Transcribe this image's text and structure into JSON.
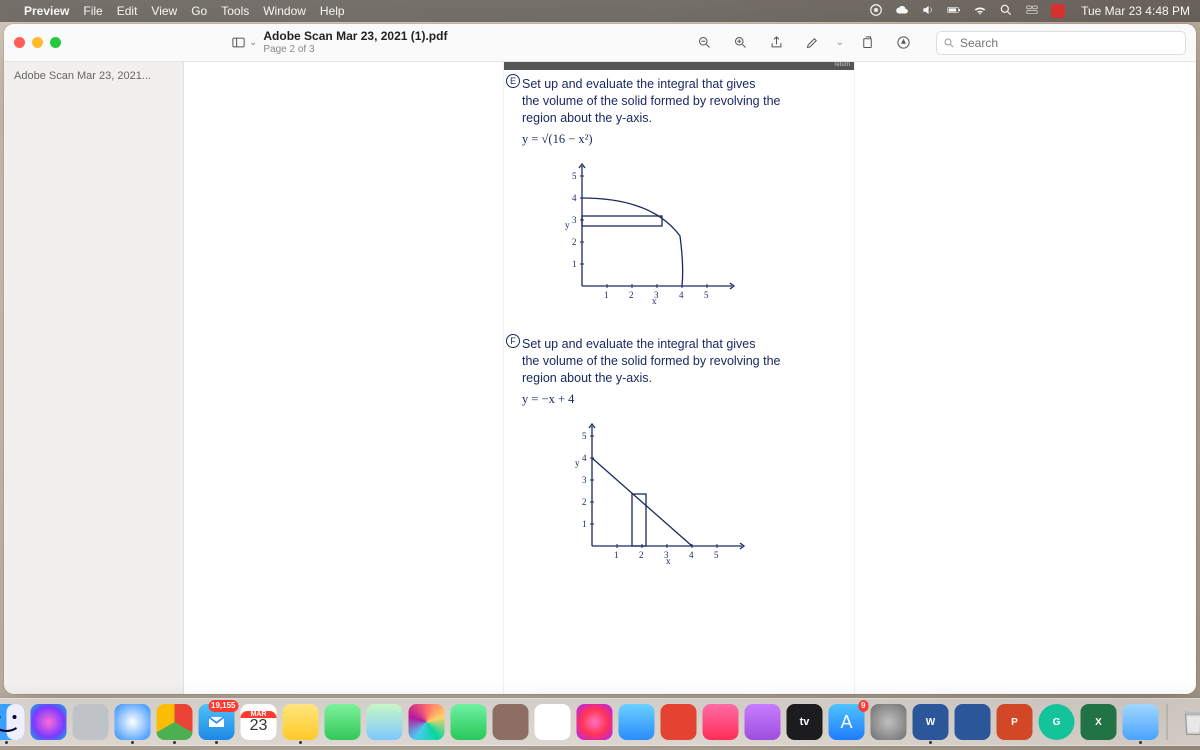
{
  "menubar": {
    "app": "Preview",
    "items": [
      "File",
      "Edit",
      "View",
      "Go",
      "Tools",
      "Window",
      "Help"
    ],
    "clock": "Tue Mar 23  4:48 PM"
  },
  "window": {
    "title": "Adobe Scan Mar 23, 2021 (1).pdf",
    "subtitle": "Page 2 of 3",
    "search_placeholder": "Search",
    "sidebar_label": "Adobe Scan Mar 23, 2021..."
  },
  "page": {
    "ruler_label": "return",
    "problem_e": {
      "id": "E",
      "lines": [
        "Set up and evaluate the integral that gives",
        "the volume of the solid formed by revolving the",
        "region about the y-axis.",
        "y = √(16 − x²)"
      ],
      "graph": {
        "ylabel": "y",
        "xlabel": "x",
        "xticks": [
          "1",
          "2",
          "3",
          "4",
          "5"
        ],
        "yticks": [
          "1",
          "2",
          "3",
          "4",
          "5"
        ]
      }
    },
    "problem_f": {
      "id": "F",
      "lines": [
        "Set up and evaluate the integral that gives",
        "the volume of the solid formed by revolving the",
        "region about the y-axis.",
        "y = −x + 4"
      ],
      "graph": {
        "ylabel": "y",
        "xlabel": "x",
        "xticks": [
          "1",
          "2",
          "3",
          "4",
          "5"
        ],
        "yticks": [
          "1",
          "2",
          "3",
          "4",
          "5"
        ]
      }
    }
  },
  "dock": {
    "calendar_month": "MAR",
    "calendar_day": "23",
    "mail_badge": "19,155",
    "appstore_badge": "9",
    "tv_label": "tv",
    "items": [
      {
        "name": "finder",
        "bg": "linear-gradient(#3aa0ff,#0a5cd8)"
      },
      {
        "name": "siri",
        "bg": "radial-gradient(circle,#ff6bd6,#7a3bff 60%,#0bd 100%)"
      },
      {
        "name": "launchpad",
        "bg": "#bfc3c8"
      },
      {
        "name": "safari",
        "bg": "radial-gradient(circle,#fff,#2a8cff)"
      },
      {
        "name": "chrome",
        "bg": "conic-gradient(#ea4335 0 120deg,#4caf50 120deg 240deg,#fbbc05 240deg 360deg)"
      },
      {
        "name": "mail",
        "bg": "linear-gradient(#4fc3f7,#1e88e5)"
      },
      {
        "name": "calendar",
        "bg": "#fff"
      },
      {
        "name": "notes",
        "bg": "linear-gradient(#ffe57f,#ffca28)"
      },
      {
        "name": "messages",
        "bg": "linear-gradient(#7cf29a,#33c75a)"
      },
      {
        "name": "maps",
        "bg": "linear-gradient(#c8f7c5,#7ec8ff)"
      },
      {
        "name": "photos",
        "bg": "conic-gradient(#ff6b6b,#ffd166,#06d6a0,#4cc9f0,#b5179e,#ff6b6b)"
      },
      {
        "name": "facetime",
        "bg": "linear-gradient(#6ef2a0,#29c75a)"
      },
      {
        "name": "contacts",
        "bg": "#8d6e63"
      },
      {
        "name": "reminders",
        "bg": "#fff"
      },
      {
        "name": "itunes",
        "bg": "radial-gradient(circle,#ff73c0,#ff3355,#b321ff)"
      },
      {
        "name": "videos",
        "bg": "linear-gradient(#6ad1ff,#2a8cff)"
      },
      {
        "name": "todoist",
        "bg": "#e44332"
      },
      {
        "name": "music",
        "bg": "linear-gradient(#ff6ba6,#ff2d55)"
      },
      {
        "name": "podcasts",
        "bg": "linear-gradient(#c77dff,#9d4edd)"
      },
      {
        "name": "tv",
        "bg": "#1c1c1e"
      },
      {
        "name": "appstore",
        "bg": "linear-gradient(#4fc3ff,#1e7cff)"
      },
      {
        "name": "settings",
        "bg": "radial-gradient(circle,#c0c0c0,#6e6e6e)"
      },
      {
        "name": "word",
        "bg": "#2b579a"
      },
      {
        "name": "onedrive",
        "bg": "#2b579a"
      },
      {
        "name": "powerpoint",
        "bg": "#d24726"
      },
      {
        "name": "grammarly",
        "bg": "#15c39a"
      },
      {
        "name": "excel",
        "bg": "#217346"
      },
      {
        "name": "preview",
        "bg": "linear-gradient(#a0d8ff,#4aa3ff)"
      }
    ]
  }
}
